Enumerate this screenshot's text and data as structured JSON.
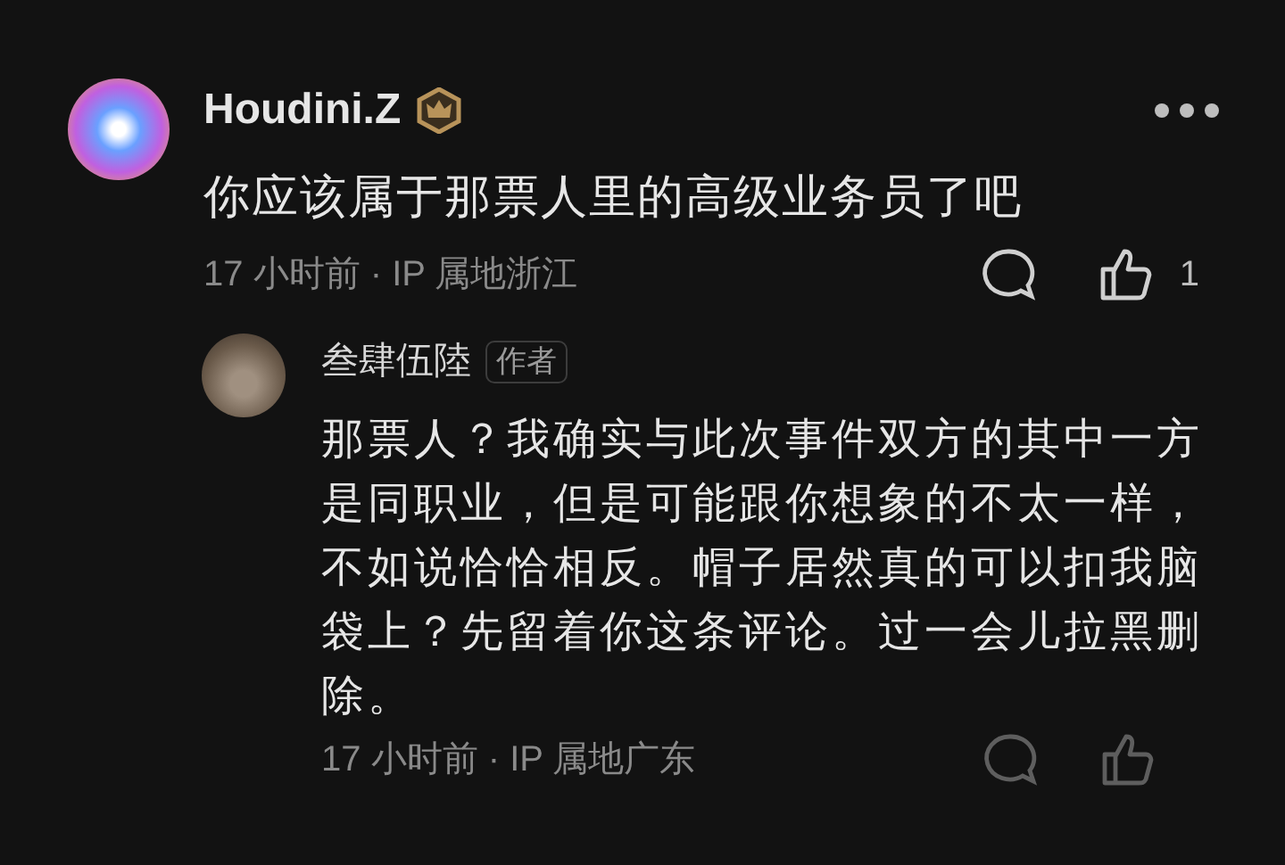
{
  "comments": [
    {
      "author": "Houdini.Z",
      "badge": true,
      "text": "你应该属于那票人里的高级业务员了吧",
      "meta": "17 小时前 · IP 属地浙江",
      "likes": "1",
      "more_menu": true,
      "replies": [
        {
          "author": "叁肆伍陸",
          "author_tag": "作者",
          "text": "那票人？我确实与此次事件双方的其中一方是同职业，但是可能跟你想象的不太一样，不如说恰恰相反。帽子居然真的可以扣我脑袋上？先留着你这条评论。过一会儿拉黑删除。",
          "meta": "17 小时前 · IP 属地广东"
        }
      ]
    }
  ]
}
